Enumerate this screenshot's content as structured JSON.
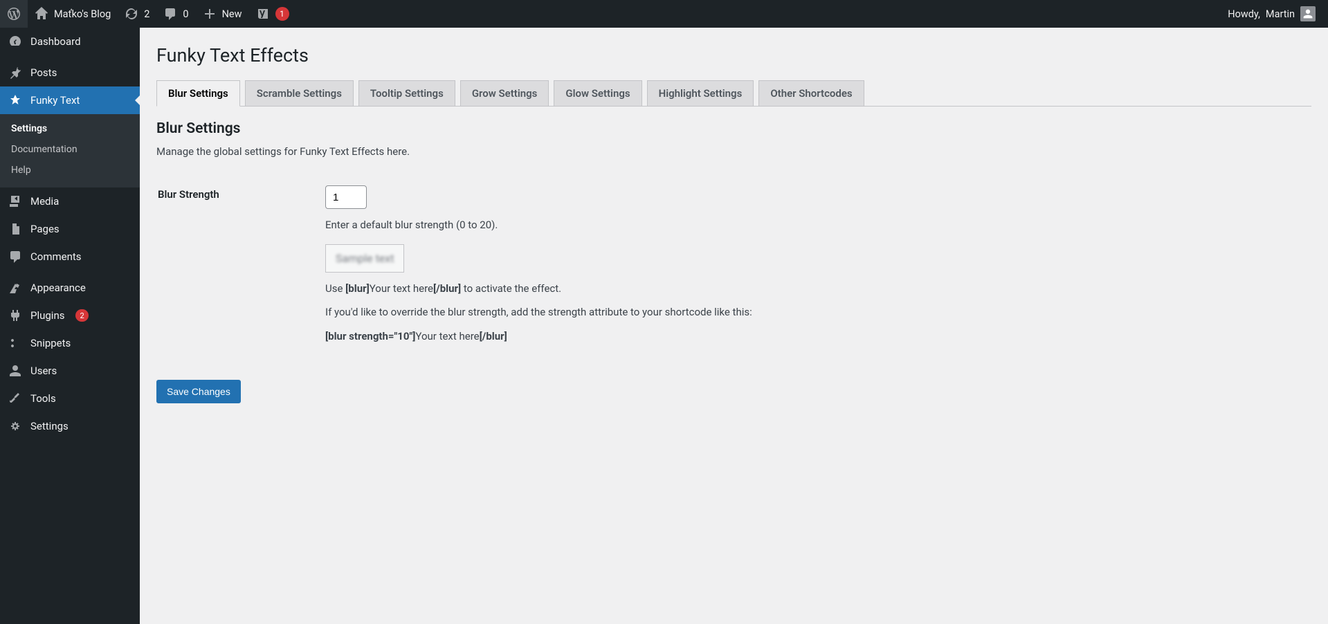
{
  "adminbar": {
    "site_name": "Maťko's Blog",
    "updates_count": "2",
    "comments_count": "0",
    "new_label": "New",
    "yoast_badge": "1",
    "howdy_prefix": "Howdy,",
    "user_name": "Martin"
  },
  "sidebar": {
    "items": [
      {
        "label": "Dashboard"
      },
      {
        "label": "Posts"
      },
      {
        "label": "Funky Text"
      },
      {
        "label": "Media"
      },
      {
        "label": "Pages"
      },
      {
        "label": "Comments"
      },
      {
        "label": "Appearance"
      },
      {
        "label": "Plugins",
        "badge": "2"
      },
      {
        "label": "Snippets"
      },
      {
        "label": "Users"
      },
      {
        "label": "Tools"
      },
      {
        "label": "Settings"
      }
    ],
    "funky_submenu": [
      {
        "label": "Settings"
      },
      {
        "label": "Documentation"
      },
      {
        "label": "Help"
      }
    ]
  },
  "page": {
    "title": "Funky Text Effects",
    "tabs": [
      "Blur Settings",
      "Scramble Settings",
      "Tooltip Settings",
      "Grow Settings",
      "Glow Settings",
      "Highlight Settings",
      "Other Shortcodes"
    ],
    "section_title": "Blur Settings",
    "section_desc": "Manage the global settings for Funky Text Effects here.",
    "field_label": "Blur Strength",
    "field_value": "1",
    "field_hint": "Enter a default blur strength (0 to 20).",
    "sample_text": "Sample text",
    "use_prefix": "Use ",
    "shortcode_open": "[blur]",
    "shortcode_inner": "Your text here",
    "shortcode_close": "[/blur]",
    "use_suffix": " to activate the effect.",
    "override_text": "If you'd like to override the blur strength, add the strength attribute to your shortcode like this:",
    "shortcode2_open": "[blur strength=\"10\"]",
    "shortcode2_inner": "Your text here",
    "shortcode2_close": "[/blur]",
    "save_button": "Save Changes"
  }
}
